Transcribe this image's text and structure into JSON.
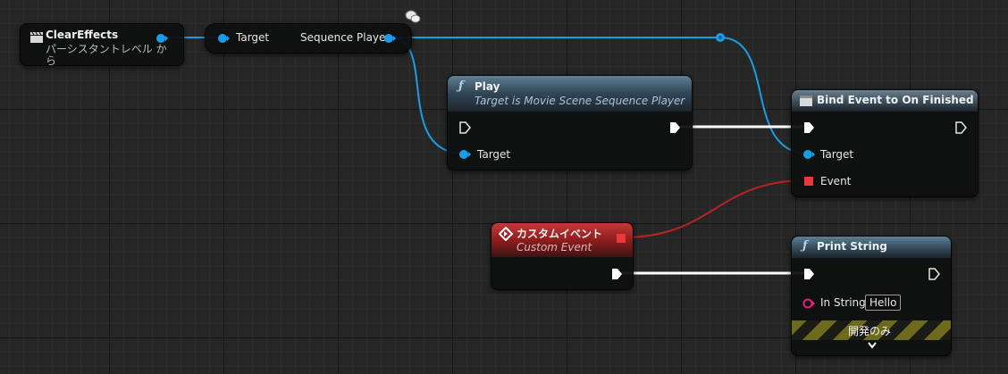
{
  "nodes": {
    "clear_effects": {
      "title": "ClearEffects",
      "subtitle_line1": "パーシスタントレベル か",
      "subtitle_line2": "ら",
      "icon": "clapperboard-icon"
    },
    "get_sequence_player": {
      "input_label": "Target",
      "output_label": "Sequence Player",
      "comment_icon": "comment-bubble-icon"
    },
    "play": {
      "title": "Play",
      "subtitle": "Target is Movie Scene Sequence Player",
      "target_label": "Target",
      "icon": "function-icon"
    },
    "bind_event": {
      "title": "Bind Event to On Finished",
      "target_label": "Target",
      "event_label": "Event",
      "icon": "window-icon"
    },
    "custom_event": {
      "title": "カスタムイベント",
      "subtitle": "Custom Event",
      "icon": "event-diamond-icon"
    },
    "print_string": {
      "title": "Print String",
      "in_string_label": "In String",
      "in_string_value": "Hello",
      "dev_only_label": "開発のみ",
      "icon": "function-icon",
      "expand_icon": "chevron-down-icon"
    }
  },
  "colors": {
    "object_pin": "#1a9de8",
    "delegate_pin": "#e83a3a",
    "string_pin": "#e5207f",
    "exec_wire": "#ffffff",
    "function_header": "#3f5a6d",
    "event_header": "#a02525"
  }
}
